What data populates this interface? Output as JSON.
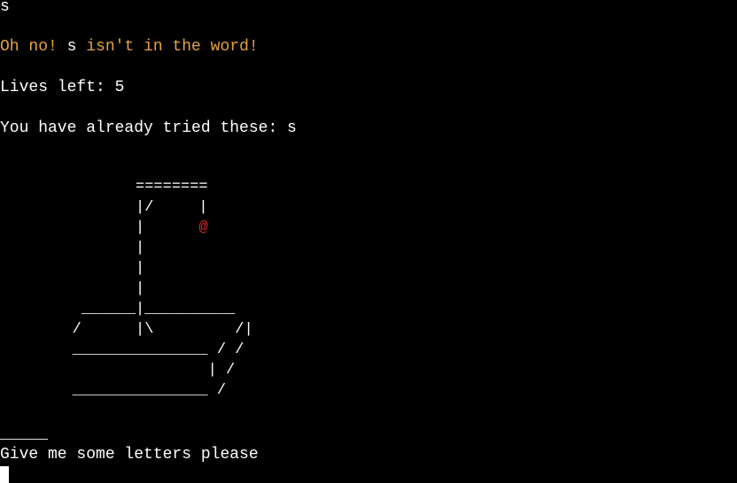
{
  "terminal": {
    "input_echo": "s",
    "feedback": {
      "prefix": "Oh no! ",
      "letter": "s",
      "suffix": " isn't in the word!"
    },
    "lives_line": "Lives left: 5",
    "tried_line": "You have already tried these: s",
    "hangman_art": {
      "rows": [
        "               ========",
        "               |/     |",
        "               |      ",
        "               |",
        "               |",
        "               |",
        "         ______|__________",
        "        /      |\\         /|",
        "        _______________ / /",
        "                       | /",
        "        _______________ /"
      ],
      "head_glyph": "@"
    },
    "word_blanks": "_____",
    "prompt": "Give me some letters please"
  },
  "colors": {
    "background": "#000000",
    "text": "#ffffff",
    "feedback": "#e5a43a",
    "head": "#e02a2a"
  }
}
